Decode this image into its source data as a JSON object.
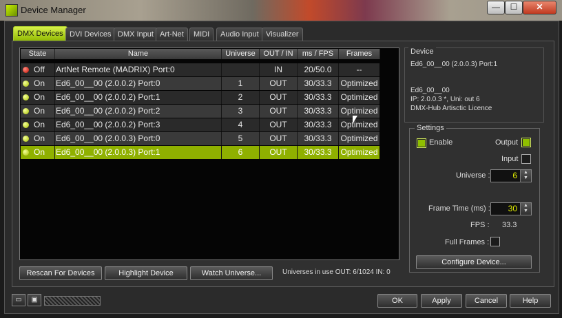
{
  "window": {
    "title": "Device Manager"
  },
  "tabs": [
    {
      "label": "DMX Devices",
      "active": true
    },
    {
      "label": "DVI Devices"
    },
    {
      "label": "DMX Input"
    },
    {
      "label": "Art-Net"
    },
    {
      "label": "MIDI"
    },
    {
      "label": "Audio Input"
    },
    {
      "label": "Visualizer"
    }
  ],
  "table": {
    "columns": [
      "State",
      "Name",
      "Universe",
      "OUT / IN",
      "ms / FPS",
      "Frames"
    ],
    "rows": [
      {
        "led": "red",
        "state": "Off",
        "name": "ArtNet Remote (MADRIX) Port:0",
        "universe": "",
        "dir": "IN",
        "fps": "20/50.0",
        "frames": "--"
      },
      {
        "led": "green",
        "state": "On",
        "name": "Ed6_00__00 (2.0.0.2) Port:0",
        "universe": "1",
        "dir": "OUT",
        "fps": "30/33.3",
        "frames": "Optimized"
      },
      {
        "led": "green",
        "state": "On",
        "name": "Ed6_00__00 (2.0.0.2) Port:1",
        "universe": "2",
        "dir": "OUT",
        "fps": "30/33.3",
        "frames": "Optimized"
      },
      {
        "led": "green",
        "state": "On",
        "name": "Ed6_00__00 (2.0.0.2) Port:2",
        "universe": "3",
        "dir": "OUT",
        "fps": "30/33.3",
        "frames": "Optimized"
      },
      {
        "led": "green",
        "state": "On",
        "name": "Ed6_00__00 (2.0.0.2) Port:3",
        "universe": "4",
        "dir": "OUT",
        "fps": "30/33.3",
        "frames": "Optimized"
      },
      {
        "led": "green",
        "state": "On",
        "name": "Ed6_00__00 (2.0.0.3) Port:0",
        "universe": "5",
        "dir": "OUT",
        "fps": "30/33.3",
        "frames": "Optimized"
      },
      {
        "led": "green",
        "state": "On",
        "name": "Ed6_00__00 (2.0.0.3) Port:1",
        "universe": "6",
        "dir": "OUT",
        "fps": "30/33.3",
        "frames": "Optimized",
        "selected": true
      }
    ]
  },
  "buttons": {
    "rescan": "Rescan For Devices",
    "highlight": "Highlight Device",
    "watch": "Watch Universe...",
    "ok": "OK",
    "apply": "Apply",
    "cancel": "Cancel",
    "help": "Help",
    "configure": "Configure Device..."
  },
  "status": {
    "universes": "Universes in use OUT: 6/1024  IN: 0"
  },
  "device": {
    "heading": "Device",
    "name": "Ed6_00__00 (2.0.0.3) Port:1",
    "short": "Ed6_00__00",
    "ip": "IP: 2.0.0.3 *, Uni: out 6",
    "type": "DMX-Hub Artisctic Licence"
  },
  "settings": {
    "heading": "Settings",
    "enable_label": "Enable",
    "enable": true,
    "output_label": "Output",
    "output": true,
    "input_label": "Input",
    "input": false,
    "universe_label": "Universe :",
    "universe_value": "6",
    "frametime_label": "Frame Time (ms) :",
    "frametime_value": "30",
    "fps_label": "FPS :",
    "fps_value": "33.3",
    "fullframes_label": "Full Frames :",
    "fullframes": false
  },
  "titlebar_buttons": {
    "minimize": "—",
    "maximize": "☐",
    "close": "✕"
  }
}
